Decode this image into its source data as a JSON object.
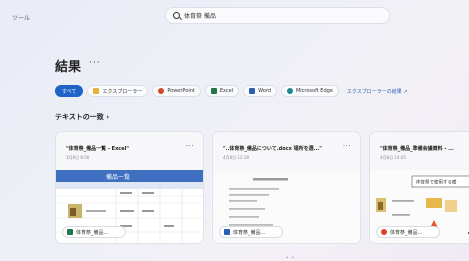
{
  "header": {
    "tools_label": "ツール",
    "search_query": "体育祭 備品"
  },
  "results": {
    "title": "結果",
    "more": "···"
  },
  "filters": [
    {
      "label": "すべて",
      "active": true
    },
    {
      "label": "エクスプローラー",
      "icon": "folder-icon",
      "color": "#e8b437"
    },
    {
      "label": "PowerPoint",
      "icon": "powerpoint-icon",
      "color": "#d24726"
    },
    {
      "label": "Excel",
      "icon": "excel-icon",
      "color": "#1d7a45"
    },
    {
      "label": "Word",
      "icon": "word-icon",
      "color": "#2b5fb4"
    },
    {
      "label": "Microsoft Edge",
      "icon": "edge-icon",
      "color": "#1c8a8f"
    }
  ],
  "explorer_link": "エクスプローラーの結果 ↗",
  "section_title": "テキストの一致 ›",
  "cards": [
    {
      "title": "\"体育祭_備品一覧 - Excel\"",
      "date": "3月8日 8:56",
      "more": "···",
      "pill": "体育祭_備品...",
      "pill_color": "#1d7a45",
      "sheet_header": "備品一覧"
    },
    {
      "title": "\"..体育祭_備品について.docx 場所を選...\"",
      "date": "4月8日 12:18",
      "more": "···",
      "pill": "体育祭_備品...",
      "pill_color": "#2b5fb4"
    },
    {
      "title": "\"体育祭_備品_準備会議資料 - ...",
      "date": "4月8日 14:45",
      "more": "···",
      "pill": "体育祭_備品...",
      "pill_color": "#d24726",
      "slide_title": "体育祭で使用する備"
    }
  ],
  "pager": "• •"
}
